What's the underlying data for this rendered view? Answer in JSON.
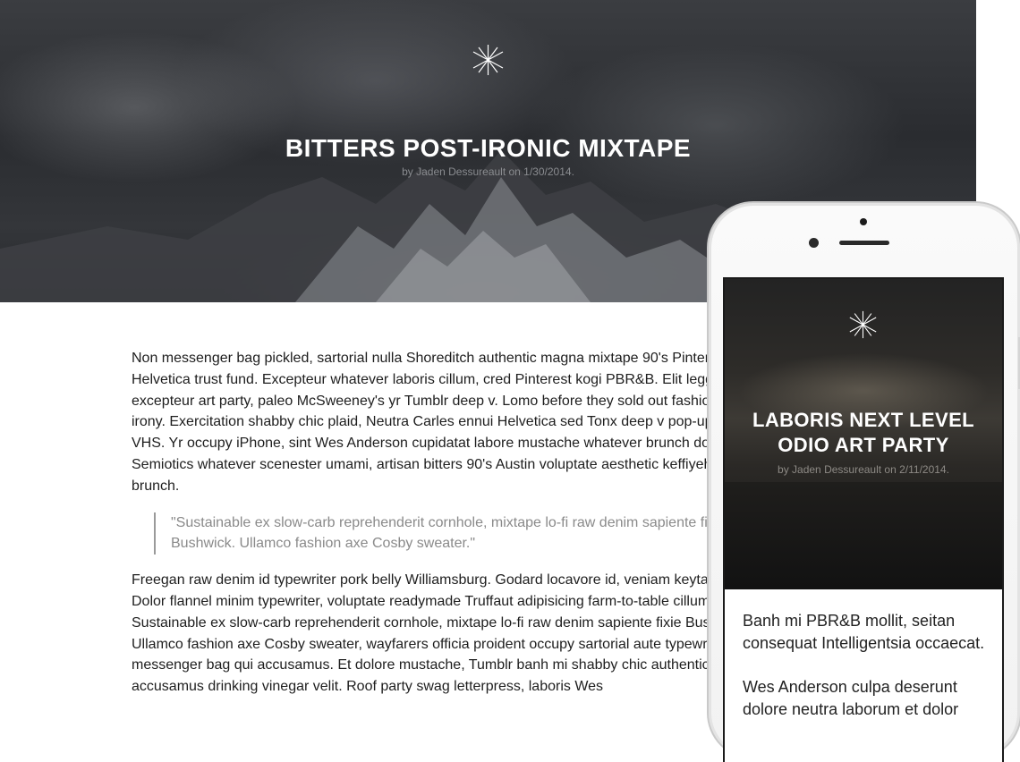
{
  "desktop": {
    "hero": {
      "logo_icon": "asterisk-star-logo",
      "title": "BITTERS POST-IRONIC MIXTAPE",
      "byline": "by Jaden Dessureault on 1/30/2014."
    },
    "article": {
      "paragraph1": "Non messenger bag pickled, sartorial nulla Shoreditch authentic magna mixtape 90's Pinterest ethical Helvetica trust fund. Excepteur whatever laboris cillum, cred Pinterest kogi PBR&B. Elit leggings excepteur art party, paleo McSweeney's yr Tumblr deep v. Lomo before they sold out fashion axe irony. Exercitation shabby chic plaid, Neutra Carles ennui Helvetica sed Tonx deep v pop-up fixie VHS. Yr occupy iPhone, sint Wes Anderson cupidatat labore mustache whatever brunch dolore. Semiotics whatever scenester umami, artisan bitters 90's Austin voluptate aesthetic keffiyeh labore brunch.",
      "quote": "\"Sustainable ex slow-carb reprehenderit cornhole, mixtape lo-fi raw denim sapiente fixie Bushwick. Ullamco fashion axe Cosby sweater.\"",
      "paragraph2": "Freegan raw denim id typewriter pork belly Williamsburg. Godard locavore id, veniam keytar hella. Dolor flannel minim typewriter, voluptate readymade Truffaut adipisicing farm-to-table cillum. Sustainable ex slow-carb reprehenderit cornhole, mixtape lo-fi raw denim sapiente fixie Bushwick. Ullamco fashion axe Cosby sweater, wayfarers officia proident occupy sartorial aute typewriter eu messenger bag qui accusamus. Et dolore mustache, Tumblr banh mi shabby chic authentic keffiyeh accusamus drinking vinegar velit. Roof party swag letterpress, laboris Wes"
    }
  },
  "mobile": {
    "logo_icon": "asterisk-star-logo",
    "title": "LABORIS NEXT LEVEL ODIO ART PARTY",
    "byline": "by Jaden Dessureault on 2/11/2014.",
    "paragraph1": "Banh mi PBR&B mollit, seitan consequat Intelligentsia occaecat.",
    "paragraph2": "Wes Anderson culpa deserunt dolore neutra laborum et dolor"
  },
  "colors": {
    "hero_dark": "#2a2c30",
    "title_white": "#ffffff",
    "byline_gray": "#8a8c90",
    "quote_gray": "#8a8a8a",
    "phone_body": "#f5f5f5"
  }
}
